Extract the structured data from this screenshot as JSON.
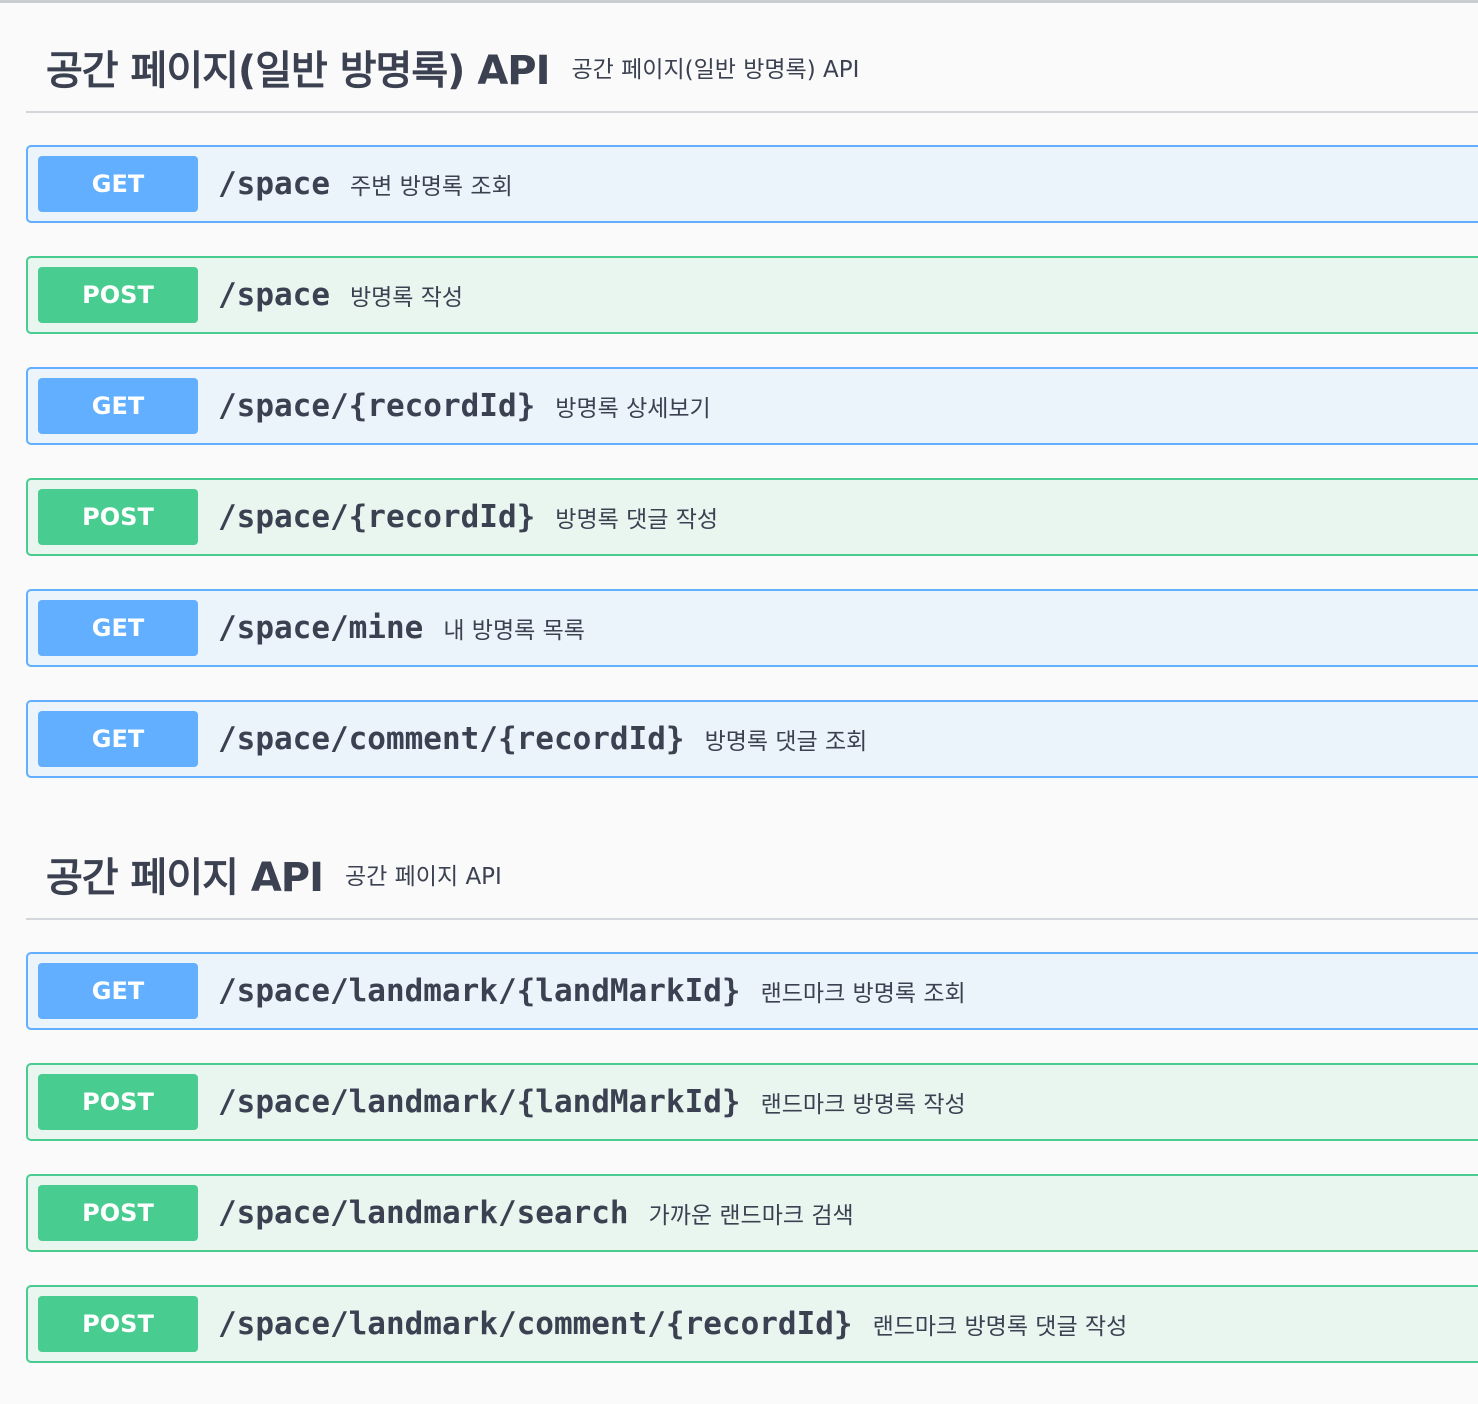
{
  "sections": [
    {
      "title": "공간 페이지(일반 방명록) API",
      "description": "공간 페이지(일반 방명록) API",
      "operations": [
        {
          "method": "GET",
          "path": "/space",
          "summary": "주변 방명록 조회"
        },
        {
          "method": "POST",
          "path": "/space",
          "summary": "방명록 작성"
        },
        {
          "method": "GET",
          "path": "/space/{recordId}",
          "summary": "방명록 상세보기"
        },
        {
          "method": "POST",
          "path": "/space/{recordId}",
          "summary": "방명록 댓글 작성"
        },
        {
          "method": "GET",
          "path": "/space/mine",
          "summary": "내 방명록 목록"
        },
        {
          "method": "GET",
          "path": "/space/comment/{recordId}",
          "summary": "방명록 댓글 조회"
        }
      ]
    },
    {
      "title": "공간 페이지 API",
      "description": "공간 페이지 API",
      "operations": [
        {
          "method": "GET",
          "path": "/space/landmark/{landMarkId}",
          "summary": "랜드마크 방명록 조회"
        },
        {
          "method": "POST",
          "path": "/space/landmark/{landMarkId}",
          "summary": "랜드마크 방명록 작성"
        },
        {
          "method": "POST",
          "path": "/space/landmark/search",
          "summary": "가까운 랜드마크 검색"
        },
        {
          "method": "POST",
          "path": "/space/landmark/comment/{recordId}",
          "summary": "랜드마크 방명록 댓글 작성"
        }
      ]
    }
  ],
  "colors": {
    "get_accent": "#61affe",
    "get_background": "#ebf3fb",
    "post_accent": "#49cc90",
    "post_background": "#e9f6f0",
    "text": "#3b4151",
    "page_background": "#fafafa"
  }
}
